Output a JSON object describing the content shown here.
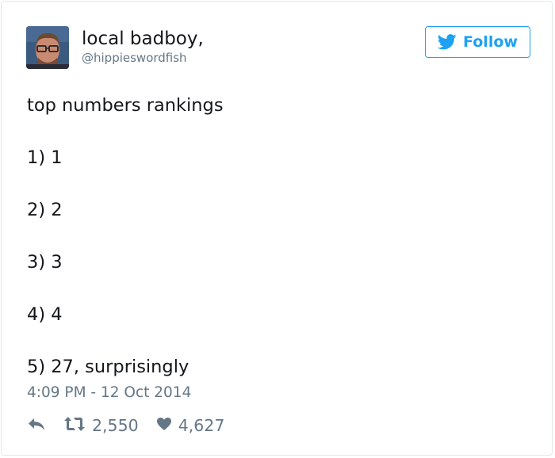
{
  "user": {
    "display_name": "local badboy,",
    "handle": "@hippieswordfish"
  },
  "follow_button": {
    "label": "Follow",
    "icon": "twitter-bird-icon"
  },
  "tweet": {
    "text": "top numbers rankings",
    "list": [
      "1) 1",
      "2) 2",
      "3) 3",
      "4) 4",
      "5) 27, surprisingly"
    ],
    "timestamp": "4:09 PM - 12 Oct 2014"
  },
  "actions": {
    "reply_icon": "reply-icon",
    "retweet_icon": "retweet-icon",
    "retweet_count": "2,550",
    "like_icon": "heart-icon",
    "like_count": "4,627"
  },
  "colors": {
    "accent": "#1da1f2",
    "text": "#14171a",
    "secondary": "#657786",
    "border": "#e1e8ed"
  }
}
